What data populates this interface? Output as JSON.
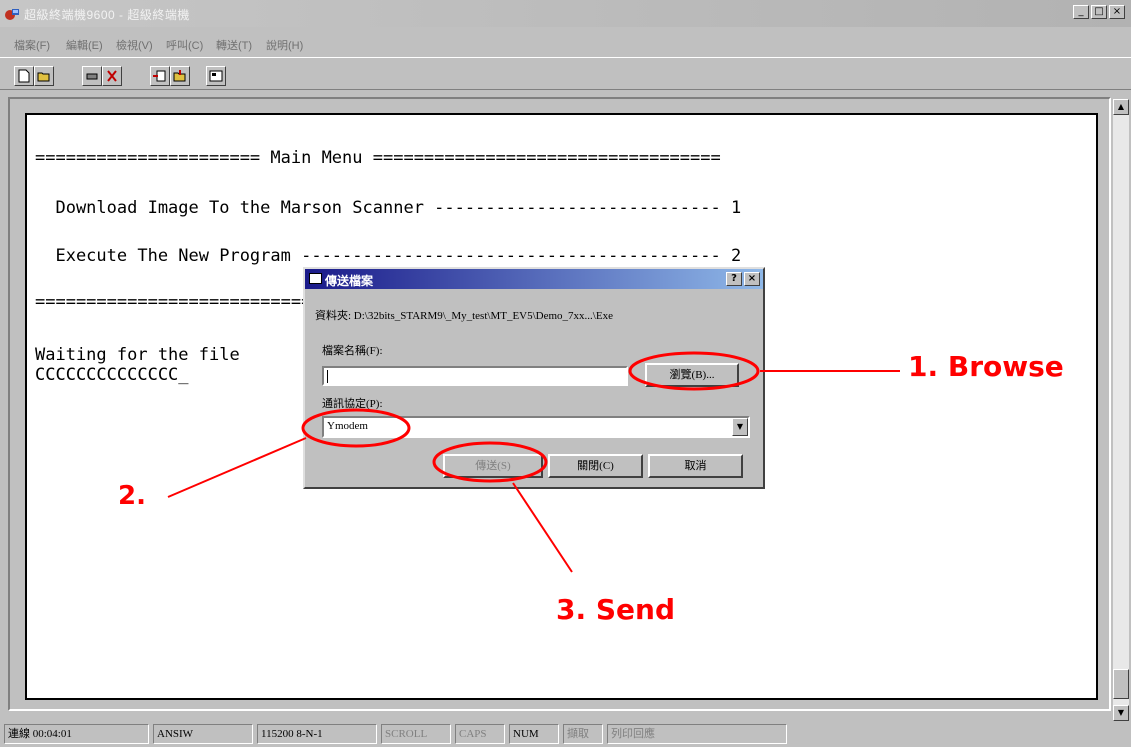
{
  "window": {
    "title": "超級終端機9600 - 超級終端機"
  },
  "window_controls": {
    "minimize": "_",
    "maximize": "□",
    "close": "×"
  },
  "menubar": {
    "items": [
      "檔案(F)",
      "編輯(E)",
      "檢視(V)",
      "呼叫(C)",
      "轉送(T)",
      "說明(H)"
    ]
  },
  "toolbar": {
    "buttons": [
      "new-icon",
      "open-icon",
      "disconnect-icon",
      "dial-icon",
      "send-icon",
      "receive-icon",
      "properties-icon"
    ]
  },
  "terminal": {
    "lines": [
      "====================== Main Menu ==================================",
      "  Download Image To the Marson Scanner ---------------------------- 1",
      "  Execute The New Program ----------------------------------------- 2",
      "==================================================================",
      "Waiting for the file                                            )",
      "CCCCCCCCCCCCCC_"
    ]
  },
  "dialog": {
    "title": "傳送檔案",
    "help_btn": "?",
    "close_btn": "×",
    "folder_label": "資料夾: D:\\32bits_STARM9\\_My_test\\MT_EV5\\Demo_7xx...\\Exe",
    "filename_label": "檔案名稱(F):",
    "filename_value": "",
    "browse_button": "瀏覽(B)...",
    "protocol_label": "通訊協定(P):",
    "protocol_value": "Ymodem",
    "send_button": "傳送(S)",
    "close_button": "關閉(C)",
    "cancel_button": "取消"
  },
  "statusbar": {
    "connected": "連線 00:04:01",
    "emulation": "ANSIW",
    "port": "115200 8-N-1",
    "scroll": "SCROLL",
    "caps": "CAPS",
    "num": "NUM",
    "capture": "擷取",
    "print_echo": "列印回應"
  },
  "annotations": {
    "step1": "1. Browse",
    "step2": "2.",
    "step3": "3.  Send",
    "color": "#ff0000"
  }
}
